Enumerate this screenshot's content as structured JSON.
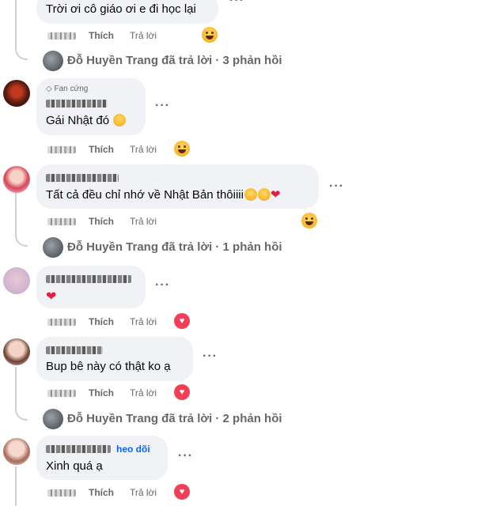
{
  "actions": {
    "like": "Thích",
    "reply": "Trả lời"
  },
  "comments": [
    {
      "text": "Trời ơi cô giáo ơi e đi học lại",
      "reaction": "haha"
    },
    {
      "badge": "Fan cứng",
      "text": "Gái Nhật đó",
      "reaction": "haha"
    },
    {
      "text": "Tất cả đều chỉ nhớ về Nhật Bản thôiiii",
      "reaction": "haha"
    },
    {
      "text": "",
      "reaction": "love"
    },
    {
      "text": "Bup bê này có thật ko ạ",
      "reaction": "love"
    },
    {
      "follow_fragment": "heo dõi",
      "text": "Xinh quá ạ",
      "reaction": "love"
    }
  ],
  "reply_threads": [
    {
      "text": "Đỗ Huyền Trang đã trả lời · 3 phản hồi"
    },
    {
      "text": "Đỗ Huyền Trang đã trả lời · 1 phản hồi"
    },
    {
      "text": "Đỗ Huyền Trang đã trả lời · 2 phản hồi"
    }
  ],
  "colors": {
    "bubble": "#f0f2f5",
    "secondary_text": "#65676b",
    "love": "#f33e58",
    "link": "#0866ff"
  }
}
